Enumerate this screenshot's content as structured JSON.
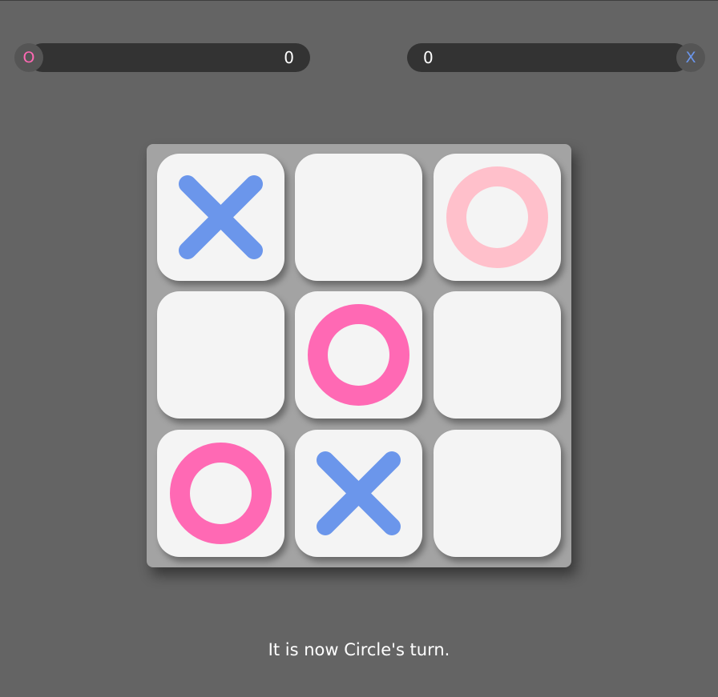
{
  "scoreboard": {
    "circle": {
      "symbol": "O",
      "score": "0",
      "color": "#ff69b4"
    },
    "cross": {
      "symbol": "X",
      "score": "0",
      "color": "#6b96eb"
    }
  },
  "board": {
    "cells": [
      {
        "mark": "X",
        "preview": false
      },
      {
        "mark": "",
        "preview": false
      },
      {
        "mark": "O",
        "preview": true
      },
      {
        "mark": "",
        "preview": false
      },
      {
        "mark": "O",
        "preview": false
      },
      {
        "mark": "",
        "preview": false
      },
      {
        "mark": "O",
        "preview": false
      },
      {
        "mark": "X",
        "preview": false
      },
      {
        "mark": "",
        "preview": false
      }
    ],
    "colors": {
      "x": "#6b96eb",
      "o": "#ff69b4",
      "o_preview": "#ffc0cb"
    }
  },
  "status": {
    "message": "It is now Circle's turn."
  }
}
